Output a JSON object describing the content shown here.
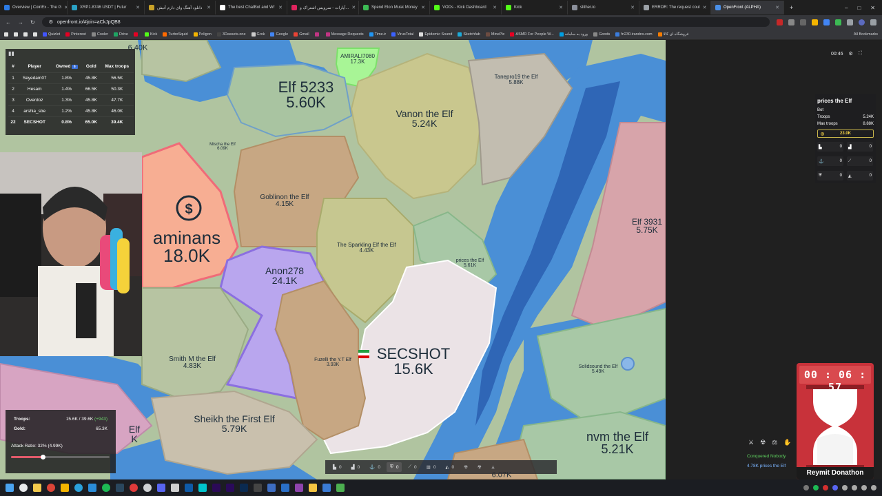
{
  "browser": {
    "tabs": [
      {
        "label": "Overview | CoinEx - The G",
        "color": "#2c7be5"
      },
      {
        "label": "XRP1.8746 USDT | Futur",
        "color": "#2aa1c4"
      },
      {
        "label": "دانلود آهنگ وای دارم آتیش",
        "color": "#c9a227"
      },
      {
        "label": "The best ChatBot and Wr",
        "color": "#ffffff"
      },
      {
        "label": "آپارات - سرویس اشتراک و...",
        "color": "#e0245e"
      },
      {
        "label": "Spend Elon Musk Money",
        "color": "#3cba54"
      },
      {
        "label": "VODs - Kick Dashboard",
        "color": "#53fc18"
      },
      {
        "label": "Kick",
        "color": "#53fc18"
      },
      {
        "label": "slither.io",
        "color": "#8a8f9a"
      },
      {
        "label": "ERROR: The request coul",
        "color": "#9aa0a6"
      },
      {
        "label": "OpenFront (ALPHA)",
        "color": "#4a8fe7"
      }
    ],
    "new_tab": "+",
    "win_min": "–",
    "win_max": "□",
    "win_close": "✕",
    "url": "openfront.io/#join=aCkJpQB8",
    "bookmarks": [
      {
        "label": "Quizlet",
        "color": "#4255ff"
      },
      {
        "label": "Pinterest",
        "color": "#e60023"
      },
      {
        "label": "Cooler",
        "color": "#888888"
      },
      {
        "label": "Drive",
        "color": "#1fa463"
      },
      {
        "label": "",
        "color": "#e60023"
      },
      {
        "label": "Kick",
        "color": "#53fc18"
      },
      {
        "label": "TurboSquid",
        "color": "#ff6a00"
      },
      {
        "label": "Poligon",
        "color": "#f4b400"
      },
      {
        "label": "3Dassets.one",
        "color": "#444444"
      },
      {
        "label": "Grok",
        "color": "#cccccc"
      },
      {
        "label": "Google",
        "color": "#4285f4"
      },
      {
        "label": "Gmail",
        "color": "#ea4335"
      },
      {
        "label": "",
        "color": "#c13584"
      },
      {
        "label": "Message Requests",
        "color": "#c13584"
      },
      {
        "label": "Time.ir",
        "color": "#2196f3"
      },
      {
        "label": "VirusTotal",
        "color": "#3b61ff"
      },
      {
        "label": "Epidemic Sound",
        "color": "#dddddd"
      },
      {
        "label": "Sketchfab",
        "color": "#1caad9"
      },
      {
        "label": "MinePic",
        "color": "#6d4c41"
      },
      {
        "label": "ASMR For People W...",
        "color": "#e60023"
      },
      {
        "label": "ورود به سامانه",
        "color": "#00a0e3"
      },
      {
        "label": "Goods",
        "color": "#888888"
      },
      {
        "label": "fn230.irandns.com",
        "color": "#3b7ddd"
      },
      {
        "label": "فروشگاه ای کالا",
        "color": "#f57c00"
      }
    ],
    "all_bookmarks": "All Bookmarks"
  },
  "leaderboard": {
    "headers": [
      "#",
      "Player",
      "Owned",
      "Gold",
      "Max troops"
    ],
    "rows": [
      {
        "rank": "1",
        "player": "Seyedam07",
        "owned": "1.8%",
        "gold": "45.8K",
        "max": "56.5K"
      },
      {
        "rank": "2",
        "player": "Hesam",
        "owned": "1.4%",
        "gold": "66.5K",
        "max": "50.3K"
      },
      {
        "rank": "3",
        "player": "Overdoz",
        "owned": "1.3%",
        "gold": "45.8K",
        "max": "47.7K"
      },
      {
        "rank": "4",
        "player": "arshia_sbe",
        "owned": "1.2%",
        "gold": "45.8K",
        "max": "46.0K"
      },
      {
        "rank": "22",
        "player": "SECSHOT",
        "owned": "0.8%",
        "gold": "65.0K",
        "max": "39.4K"
      }
    ],
    "sort_badge": "⇩"
  },
  "map_labels": [
    {
      "name": "",
      "troops": "6.40K",
      "size": 11
    },
    {
      "name": "AMIRALI7080",
      "troops": "17.3K",
      "size": 8
    },
    {
      "name": "Elf 5233",
      "troops": "5.60K",
      "size": 22
    },
    {
      "name": "Vanon the Elf",
      "troops": "5.24K",
      "size": 14
    },
    {
      "name": "Tanepro19 the Elf",
      "troops": "5.88K",
      "size": 8
    },
    {
      "name": "Mischa the Elf",
      "troops": "6.09K",
      "size": 6
    },
    {
      "name": "Goblinon the Elf",
      "troops": "4.15K",
      "size": 10
    },
    {
      "name": "aminans",
      "troops": "18.0K",
      "size": 26
    },
    {
      "name": "Anon278",
      "troops": "24.1K",
      "size": 14
    },
    {
      "name": "The Sparkling Elf the Elf",
      "troops": "4.43K",
      "size": 8
    },
    {
      "name": "prices the Elf",
      "troops": "5.61K",
      "size": 7
    },
    {
      "name": "Elf 3931",
      "troops": "5.75K",
      "size": 12
    },
    {
      "name": "SECSHOT",
      "troops": "15.6K",
      "size": 22
    },
    {
      "name": "Smith M the Elf",
      "troops": "4.83K",
      "size": 10
    },
    {
      "name": "Fuzelli the Y.T Elf",
      "troops": "3.93K",
      "size": 7
    },
    {
      "name": "Sheikh the First Elf",
      "troops": "5.79K",
      "size": 14
    },
    {
      "name": "Solidsound the Elf",
      "troops": "5.49K",
      "size": 7
    },
    {
      "name": "nvm the Elf",
      "troops": "5.21K",
      "size": 18
    },
    {
      "name": "",
      "troops": "6.07K",
      "size": 11
    },
    {
      "name": "Elf",
      "troops": "K",
      "size": 14
    }
  ],
  "stats": {
    "troops_label": "Troops:",
    "troops_value": "15.6K / 39.6K",
    "troops_plus": "(+943)",
    "gold_label": "Gold:",
    "gold_value": "65.3K",
    "attack_label": "Attack Ratio: 32% (4.99K)",
    "attack_ratio": 0.32
  },
  "top_right": {
    "time": "00:46",
    "gear": "⚙",
    "expand": "⛶"
  },
  "player_info": {
    "name": "prices the Elf",
    "type": "Bot",
    "troops_label": "Troops",
    "troops_value": "5.24K",
    "max_label": "Max troops",
    "max_value": "8.88K",
    "gold": "23.0K",
    "buildings": [
      {
        "icon": "city-icon",
        "glyph": "▙",
        "value": "0"
      },
      {
        "icon": "factory-icon",
        "glyph": "▟",
        "value": "0"
      },
      {
        "icon": "port-icon",
        "glyph": "⚓",
        "value": "0"
      },
      {
        "icon": "missile-silo-icon",
        "glyph": "⟋",
        "value": "0"
      },
      {
        "icon": "defense-post-icon",
        "glyph": "⛨",
        "value": "0"
      },
      {
        "icon": "sam-icon",
        "glyph": "◭",
        "value": "0"
      }
    ]
  },
  "timer": {
    "digits": "00 : 06 : 57",
    "name": "Reymit Donathon"
  },
  "events": {
    "line1": "Conquered Nobody",
    "line2": "4.78K prices the Elf"
  },
  "buildbar": [
    {
      "icon": "city-icon",
      "glyph": "▙",
      "value": "0",
      "selected": false
    },
    {
      "icon": "factory-icon",
      "glyph": "▟",
      "value": "0",
      "selected": false
    },
    {
      "icon": "port-icon",
      "glyph": "⚓",
      "value": "0",
      "selected": false
    },
    {
      "icon": "defense-icon",
      "glyph": "⛨",
      "value": "0",
      "selected": true
    },
    {
      "icon": "missile-icon",
      "glyph": "⟋",
      "value": "0",
      "selected": false
    },
    {
      "icon": "sam-icon",
      "glyph": "▥",
      "value": "0",
      "selected": false
    },
    {
      "icon": "warship-icon",
      "glyph": "◭",
      "value": "0",
      "selected": false
    },
    {
      "icon": "atom-bomb-icon",
      "glyph": "☢",
      "value": "",
      "selected": false
    },
    {
      "icon": "hydrogen-bomb-icon",
      "glyph": "☢",
      "value": "",
      "selected": false
    },
    {
      "icon": "mirv-icon",
      "glyph": "⚶",
      "value": "",
      "selected": false
    }
  ],
  "colors": {
    "ocean": "#4a8fd6",
    "ocean_deep": "#2f66b6",
    "land": "#9bb98d",
    "secshot": "#ebe3e6",
    "aminans": "#f5a88c",
    "anon": "#b9a6ee",
    "amirali": "#9ff38d",
    "timer_red": "#c8323a"
  }
}
